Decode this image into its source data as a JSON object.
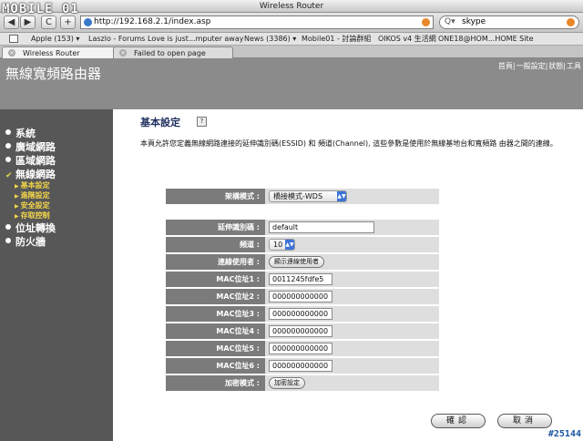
{
  "window": {
    "title": "Wireless Router"
  },
  "toolbar": {
    "back": "◀",
    "forward": "▶",
    "reload": "C",
    "add": "+",
    "url": "http://192.168.2.1/index.asp",
    "search_value": "skype"
  },
  "bookmarks": [
    "Apple (153) ▾",
    "Laszlo - Forums",
    "Love is just...mputer away",
    "News (3386) ▾",
    "Mobile01 - 討論群組",
    "OIKOS v4 生活網",
    "ONE18@HOM...HOME Site"
  ],
  "tabs": [
    {
      "label": "Wireless Router"
    },
    {
      "label": "Failed to open page"
    }
  ],
  "header": {
    "brand": "無線寬頻路由器",
    "links": [
      "首頁",
      "一般設定",
      "狀態",
      "工具"
    ]
  },
  "sidebar": {
    "items": [
      {
        "label": "系統",
        "marker": "dot"
      },
      {
        "label": "廣域網路",
        "marker": "dot"
      },
      {
        "label": "區域網路",
        "marker": "dot"
      },
      {
        "label": "無線網路",
        "marker": "check"
      }
    ],
    "subitems": [
      "基本設定",
      "進階設定",
      "安全設定",
      "存取控制"
    ],
    "items_after": [
      {
        "label": "位址轉換",
        "marker": "dot"
      },
      {
        "label": "防火牆",
        "marker": "dot"
      }
    ]
  },
  "main": {
    "title": "基本設定",
    "description": "本頁允許您定義無線網路連接的延伸識別碼(ESSID) 和 頻道(Channel), 這些參數是使用於無線基地台和寬頻路 由器之間的連線。",
    "mode": {
      "label": "架構模式 :",
      "value": "橋接模式-WDS"
    },
    "essid": {
      "label": "延伸識別碼 :",
      "value": "default"
    },
    "channel": {
      "label": "頻道 :",
      "value": "10"
    },
    "connected": {
      "label": "連線使用者 :",
      "button": "顯示連線使用者"
    },
    "macs": [
      {
        "label": "MAC位址1 :",
        "value": "0011245fdfe5"
      },
      {
        "label": "MAC位址2 :",
        "value": "000000000000"
      },
      {
        "label": "MAC位址3 :",
        "value": "000000000000"
      },
      {
        "label": "MAC位址4 :",
        "value": "000000000000"
      },
      {
        "label": "MAC位址5 :",
        "value": "000000000000"
      },
      {
        "label": "MAC位址6 :",
        "value": "000000000000"
      }
    ],
    "encryption": {
      "label": "加密模式 :",
      "button": "加密設定"
    },
    "ok_button": "確認",
    "cancel_button": "取消"
  },
  "overlay": {
    "logo": "MOBILE 01",
    "post_id": "#25144"
  },
  "colors": {
    "header_bg": "#8b8b8b",
    "sidebar_bg": "#575757",
    "label_bg": "#7b7b7b",
    "value_bg": "#dedede",
    "submenu_text": "#f3d64a",
    "title_text": "#1e2d5c"
  }
}
